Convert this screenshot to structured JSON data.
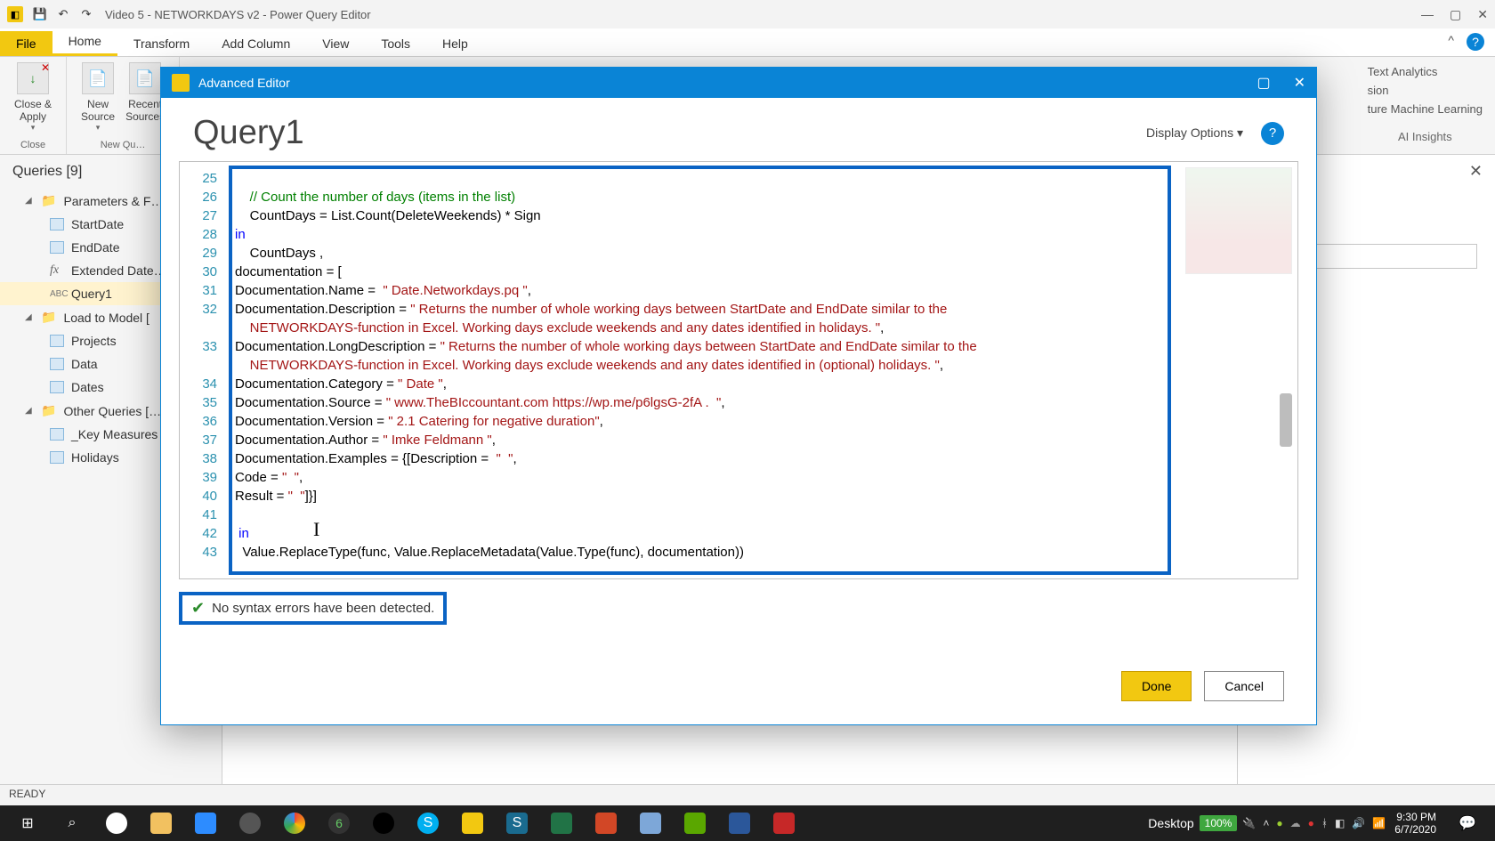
{
  "window": {
    "title": "Video 5 - NETWORKDAYS v2 - Power Query Editor"
  },
  "file_tab": "File",
  "tabs": [
    "Home",
    "Transform",
    "Add Column",
    "View",
    "Tools",
    "Help"
  ],
  "active_tab": "Home",
  "ribbon_buttons": {
    "close_apply": "Close &\nApply",
    "new_source": "New\nSource",
    "recent_sources": "Recent\nSources"
  },
  "ribbon_groups": {
    "close": "Close",
    "new_query": "New Qu…"
  },
  "ai": {
    "text_analytics": "Text Analytics",
    "vision": "sion",
    "ml": "ture Machine Learning",
    "group": "AI Insights"
  },
  "queries": {
    "title": "Queries [9]",
    "groups": [
      {
        "name": "Parameters & F…",
        "items": [
          {
            "name": "StartDate",
            "kind": "table"
          },
          {
            "name": "EndDate",
            "kind": "table"
          },
          {
            "name": "Extended Date…",
            "kind": "fx"
          },
          {
            "name": "Query1",
            "kind": "abc",
            "selected": true
          }
        ]
      },
      {
        "name": "Load to Model [",
        "items": [
          {
            "name": "Projects",
            "kind": "table"
          },
          {
            "name": "Data",
            "kind": "table"
          },
          {
            "name": "Dates",
            "kind": "table"
          }
        ]
      },
      {
        "name": "Other Queries […",
        "items": [
          {
            "name": "_Key Measures",
            "kind": "table"
          },
          {
            "name": "Holidays",
            "kind": "table"
          }
        ]
      }
    ]
  },
  "dialog": {
    "title": "Advanced Editor",
    "heading": "Query1",
    "display_options": "Display Options",
    "status": "No syntax errors have been detected.",
    "done": "Done",
    "cancel": "Cancel",
    "lines": [
      25,
      26,
      27,
      28,
      29,
      30,
      31,
      32,
      33,
      34,
      35,
      36,
      37,
      38,
      39,
      40,
      41,
      42,
      43
    ],
    "code": [
      {
        "n": 25,
        "t": "",
        "cls": ""
      },
      {
        "n": 26,
        "t": "    // Count the number of days (items in the list)",
        "cls": "c-comment"
      },
      {
        "n": 27,
        "t": "    CountDays = List.Count(DeleteWeekends) * Sign",
        "cls": ""
      },
      {
        "n": 28,
        "t": "in",
        "cls": "c-kw"
      },
      {
        "n": 29,
        "t": "    CountDays ,",
        "cls": ""
      },
      {
        "n": 30,
        "t": "documentation = [",
        "cls": ""
      },
      {
        "n": 31,
        "pre": "Documentation.Name =  ",
        "str": "\" Date.Networkdays.pq \"",
        "post": ","
      },
      {
        "n": 32,
        "pre": "Documentation.Description = ",
        "str": "\" Returns the number of whole working days between StartDate and EndDate similar to the\n    NETWORKDAYS-function in Excel. Working days exclude weekends and any dates identified in holidays. \"",
        "post": ","
      },
      {
        "n": 33,
        "pre": "Documentation.LongDescription = ",
        "str": "\" Returns the number of whole working days between StartDate and EndDate similar to the\n    NETWORKDAYS-function in Excel. Working days exclude weekends and any dates identified in (optional) holidays. \"",
        "post": ","
      },
      {
        "n": 34,
        "pre": "Documentation.Category = ",
        "str": "\" Date \"",
        "post": ","
      },
      {
        "n": 35,
        "pre": "Documentation.Source = ",
        "str": "\" www.TheBIccountant.com https://wp.me/p6lgsG-2fA .  \"",
        "post": ","
      },
      {
        "n": 36,
        "pre": "Documentation.Version = ",
        "str": "\" 2.1 Catering for negative duration\"",
        "post": ","
      },
      {
        "n": 37,
        "pre": "Documentation.Author = ",
        "str": "\" Imke Feldmann \"",
        "post": ","
      },
      {
        "n": 38,
        "pre": "Documentation.Examples = {[Description = ",
        "str": " \"  \"",
        "post": ","
      },
      {
        "n": 39,
        "pre": "Code = ",
        "str": "\"  \"",
        "post": ","
      },
      {
        "n": 40,
        "pre": "Result = ",
        "str": "\"  \"",
        "post": "]}]"
      },
      {
        "n": 41,
        "t": "",
        "cls": ""
      },
      {
        "n": 42,
        "t": " in",
        "cls": "c-kw"
      },
      {
        "n": 43,
        "t": "  Value.ReplaceType(func, Value.ReplaceMetadata(Value.Type(func), documentation))",
        "cls": ""
      }
    ]
  },
  "status": "READY",
  "taskbar": {
    "desktop": "Desktop",
    "battery": "100%",
    "time": "9:30 PM",
    "date": "6/7/2020"
  }
}
